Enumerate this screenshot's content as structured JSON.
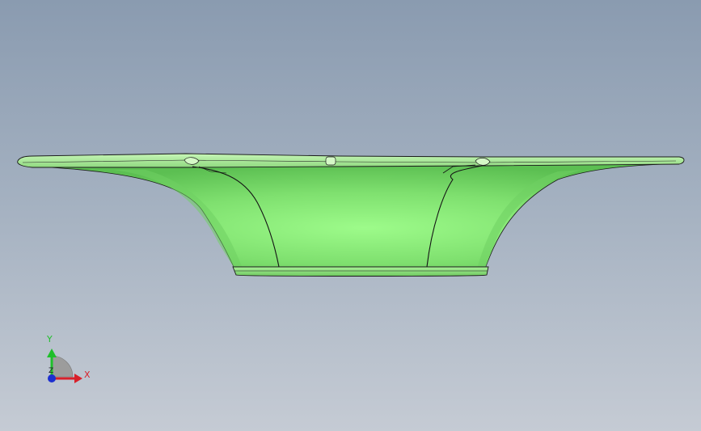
{
  "viewport": {
    "background_top": "#8a9bb0",
    "background_bottom": "#c5cbd4",
    "model_color": "#8ce07a",
    "model_shade": "#5fbf55",
    "edge_color": "#1a1a1a"
  },
  "triad": {
    "x_label": "X",
    "y_label": "Y",
    "z_label": "Z",
    "x_color": "#d8202a",
    "y_color": "#1fbf2a",
    "z_color": "#1c2fd0"
  }
}
